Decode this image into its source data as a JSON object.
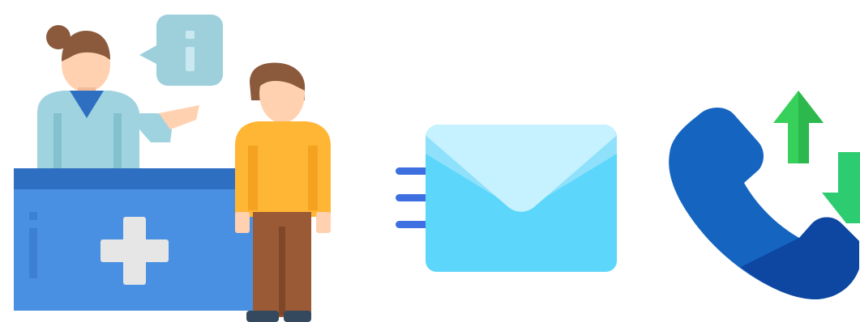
{
  "illustrations": [
    {
      "icon": "reception-desk-icon"
    },
    {
      "icon": "email-envelope-icon"
    },
    {
      "icon": "phone-call-icon"
    }
  ],
  "colors": {
    "desk": "#4a90e2",
    "desk_dark": "#2f6fc1",
    "cross": "#e6e6e6",
    "receptionist_top": "#9fd3df",
    "skin": "#ffd1b0",
    "hair": "#8b5a3c",
    "patient_shirt": "#ffb634",
    "patient_pants": "#9a5a35",
    "bubble": "#9ed0dc",
    "envelope_back": "#8fe1fb",
    "envelope_flap": "#c6f2ff",
    "envelope_front": "#5cd6fa",
    "speed_lines": "#3d6fe0",
    "phone": "#1565c0",
    "phone_dark": "#0d47a1",
    "arrow_up": "#37d05a",
    "arrow_down": "#2ecc71"
  }
}
